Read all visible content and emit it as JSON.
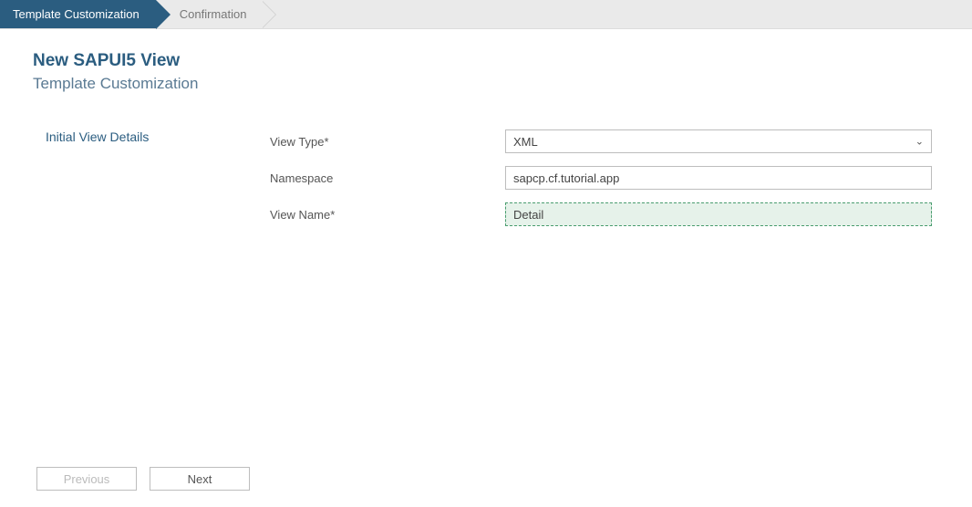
{
  "wizard": {
    "steps": [
      {
        "label": "Template Customization",
        "active": true
      },
      {
        "label": "Confirmation",
        "active": false
      }
    ]
  },
  "header": {
    "title": "New SAPUI5 View",
    "subtitle": "Template Customization"
  },
  "section": {
    "title": "Initial View Details"
  },
  "form": {
    "viewType": {
      "label": "View Type*",
      "value": "XML"
    },
    "namespace": {
      "label": "Namespace",
      "value": "sapcp.cf.tutorial.app"
    },
    "viewName": {
      "label": "View Name*",
      "value": "Detail"
    }
  },
  "buttons": {
    "previous": "Previous",
    "next": "Next"
  }
}
